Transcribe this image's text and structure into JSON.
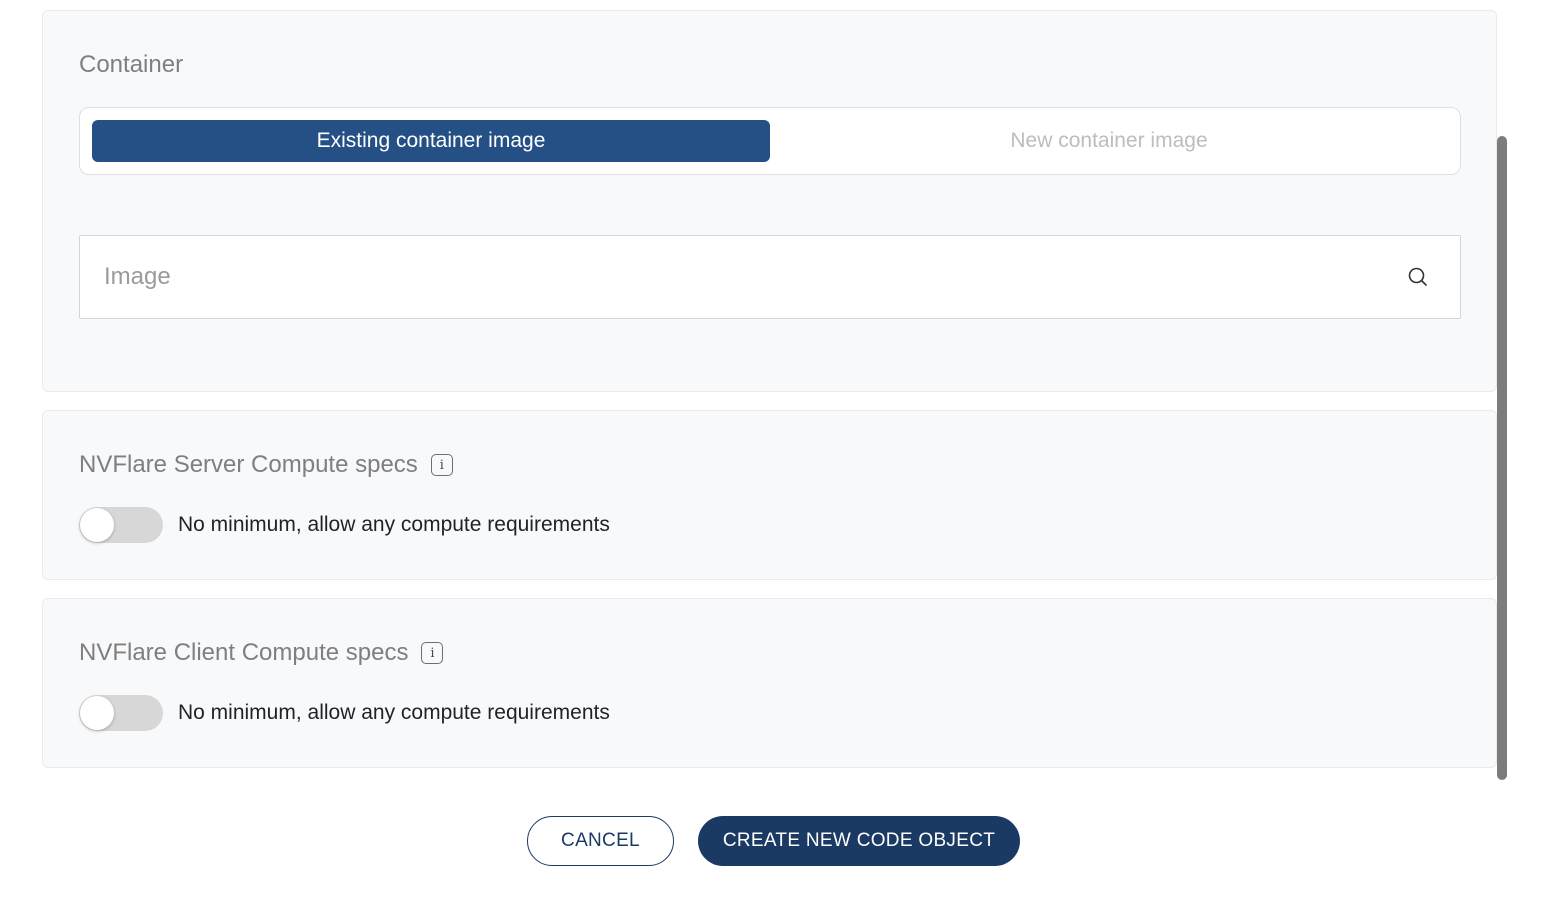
{
  "container_section": {
    "title": "Container",
    "tabs": [
      {
        "label": "Existing container image",
        "selected": true
      },
      {
        "label": "New container image",
        "selected": false
      }
    ],
    "image_field": {
      "placeholder": "Image",
      "value": ""
    }
  },
  "server_specs": {
    "title": "NVFlare Server Compute specs",
    "info_icon": "info-icon",
    "toggle_on": false,
    "toggle_label": "No minimum, allow any compute requirements"
  },
  "client_specs": {
    "title": "NVFlare Client Compute specs",
    "info_icon": "info-icon",
    "toggle_on": false,
    "toggle_label": "No minimum, allow any compute requirements"
  },
  "footer": {
    "cancel_label": "CANCEL",
    "create_label": "CREATE NEW CODE OBJECT"
  },
  "colors": {
    "accent": "#245086",
    "primary_button": "#1b3a63",
    "panel_bg": "#f8f9fb"
  }
}
